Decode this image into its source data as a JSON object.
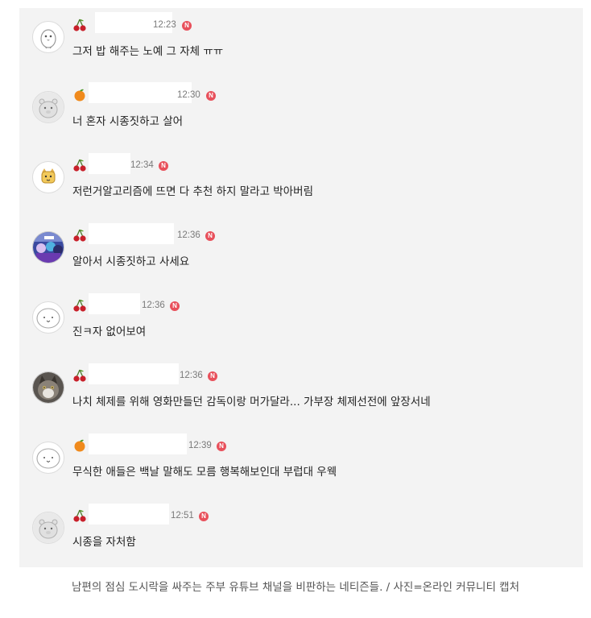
{
  "comments": [
    {
      "badge": "cherry",
      "avatar": "penguin-avatar",
      "time": "12:23",
      "verified": "N",
      "text": "그저 밥 해주는 노예 그 자체 ㅠㅠ"
    },
    {
      "badge": "orange",
      "avatar": "bear-avatar",
      "time": "12:30",
      "verified": "N",
      "text": "너 혼자 시종짓하고 살어"
    },
    {
      "badge": "cherry",
      "avatar": "cat-sticker-avatar",
      "time": "12:34",
      "verified": "N",
      "text": "저런거알고리즘에 뜨면 다 추천 하지 말라고 박아버림"
    },
    {
      "badge": "cherry",
      "avatar": "photo-avatar",
      "time": "12:36",
      "verified": "N",
      "text": "알아서 시종짓하고 사세요"
    },
    {
      "badge": "cherry",
      "avatar": "blob-avatar",
      "time": "12:36",
      "verified": "N",
      "text": "진ㅋ자 없어보여"
    },
    {
      "badge": "cherry",
      "avatar": "cat-photo-avatar",
      "time": "12:36",
      "verified": "N",
      "text": "나치 체제를 위해 영화만들던 감독이랑 머가달라... 가부장 체제선전에 앞장서네"
    },
    {
      "badge": "orange",
      "avatar": "blob-avatar",
      "time": "12:39",
      "verified": "N",
      "text": "무식한 애들은 백날 말해도 모름 행복해보인대 부럽대 우웩"
    },
    {
      "badge": "cherry",
      "avatar": "bear-avatar",
      "time": "12:51",
      "verified": "N",
      "text": "시종을 자처함"
    }
  ],
  "caption": "남편의 점심 도시락을 싸주는 주부 유튜브 채널을 비판하는 네티즌들. / 사진=온라인 커뮤니티 캡처",
  "colors": {
    "panel": "#f3f3f3",
    "text": "#222222",
    "time": "#7a7a7a",
    "n_badge": "#e8505b",
    "cherry": "#c8202a",
    "orange": "#f08a1c"
  }
}
